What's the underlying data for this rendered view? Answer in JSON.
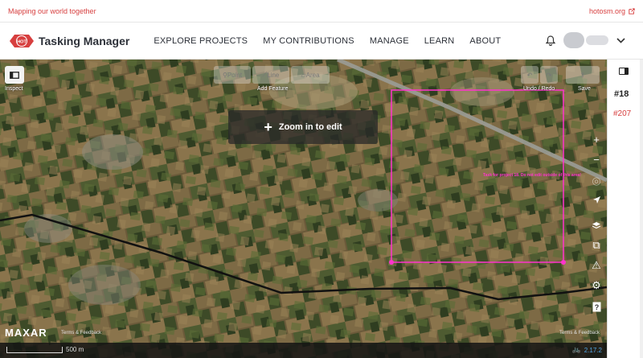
{
  "top_strip": {
    "tagline": "Mapping our world together",
    "link": "hotosm.org"
  },
  "header": {
    "app_title": "Tasking Manager",
    "logo_text": "HOT",
    "nav": [
      "EXPLORE PROJECTS",
      "MY CONTRIBUTIONS",
      "MANAGE",
      "LEARN",
      "ABOUT"
    ]
  },
  "map": {
    "inspect_label": "Inspect",
    "tools": {
      "point": "Point",
      "line": "Line",
      "area": "Area"
    },
    "add_feature_label": "Add Feature",
    "undo_redo_label": "Undo / Redo",
    "save_label": "Save",
    "zoom_in_to_edit": "Zoom in to edit",
    "task_label": "Task for project 18. Do not edit outside of this area!",
    "maxar": "MAXAR",
    "terms_left": "Terms & Feedback",
    "terms_right": "Terms & Feedback",
    "scale_label": "500 m",
    "version": "2.17.2",
    "right_controls": [
      "zoom-in",
      "zoom-out",
      "geolocate",
      "locate",
      "layers",
      "map-data",
      "issues",
      "preferences",
      "help"
    ]
  },
  "sidebar": {
    "project_id": "#18",
    "task_id": "#207"
  },
  "colors": {
    "accent": "#d73f3f",
    "task_outline": "#ff33cc",
    "version": "#4fa3e0"
  }
}
